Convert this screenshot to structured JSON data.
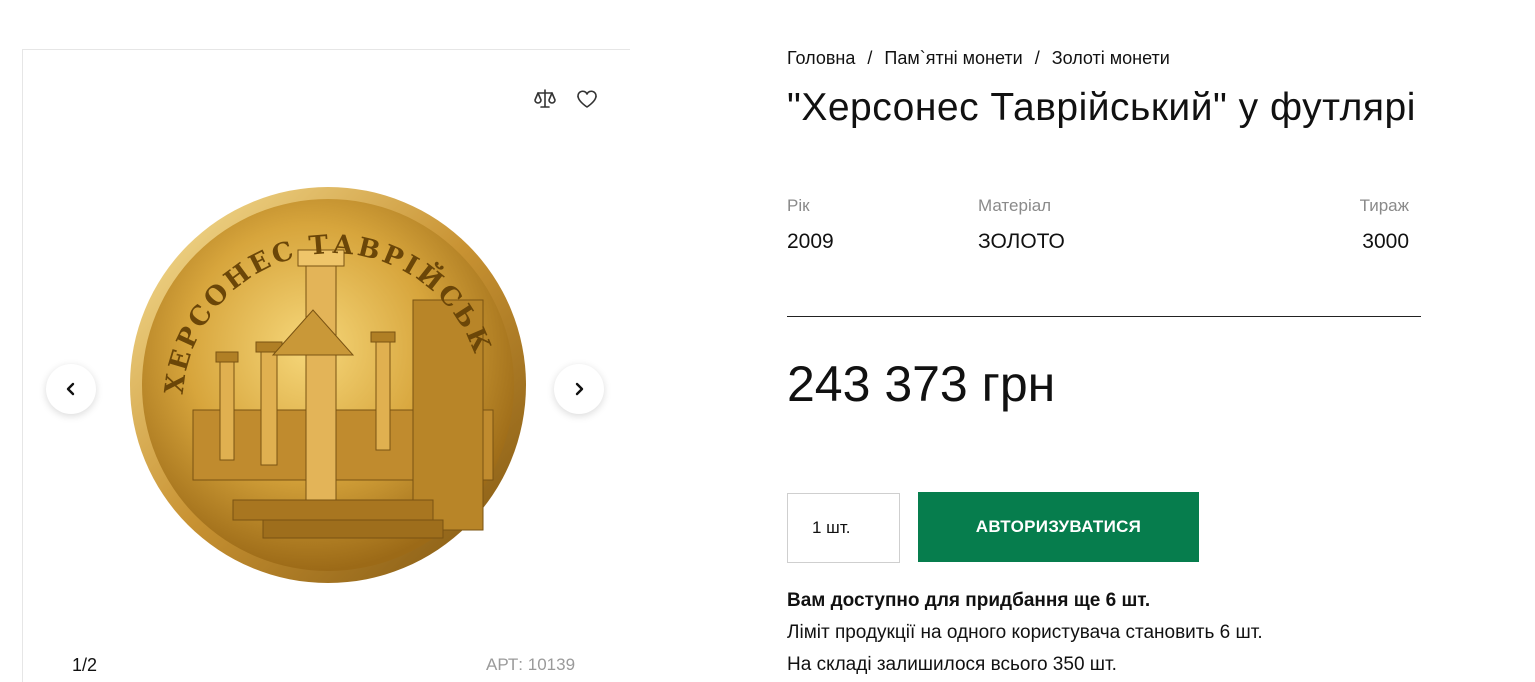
{
  "gallery": {
    "counter": "1/2",
    "sku": "АРТ: 10139",
    "coin_inscription": "ХЕРСОНЕС ТАВРІЙСЬКИЙ",
    "icons": {
      "compare": "scales-icon",
      "favorite": "heart-icon",
      "prev": "chevron-left-icon",
      "next": "chevron-right-icon"
    }
  },
  "breadcrumb": {
    "items": [
      "Головна",
      "Пам`ятні монети",
      "Золоті монети"
    ],
    "separator": "/"
  },
  "product": {
    "title": "\"Херсонес Таврійський\" у футлярі",
    "specs": {
      "year_label": "Рік",
      "year": "2009",
      "material_label": "Матеріал",
      "material": "ЗОЛОТО",
      "mintage_label": "Тираж",
      "mintage": "3000"
    },
    "price": "243 373 грн",
    "quantity": "1 шт.",
    "auth_button": "АВТОРИЗУВАТИСЯ",
    "notes": {
      "available": "Вам доступно для придбання ще 6 шт.",
      "limit": "Ліміт продукції на одного користувача становить 6 шт.",
      "stock": "На складі залишилося всього 350 шт."
    }
  },
  "colors": {
    "accent": "#067d4d",
    "gold": "#d2a23a"
  }
}
